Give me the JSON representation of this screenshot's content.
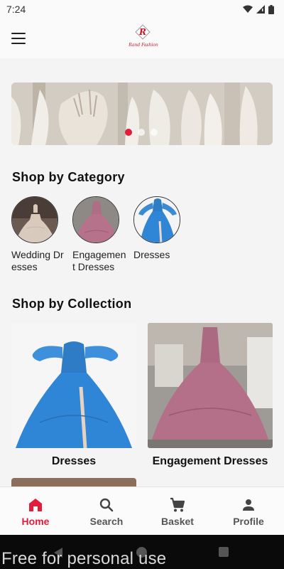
{
  "status_bar": {
    "time": "7:24"
  },
  "header": {
    "logo_text": "Rand Fashion",
    "logo_letter": "R"
  },
  "banner": {
    "slide_count": 3,
    "active_slide": 1
  },
  "category_section": {
    "title": "Shop by Category",
    "items": [
      {
        "label": "Wedding Dresses"
      },
      {
        "label": "Engagement Dresses"
      },
      {
        "label": "Dresses"
      }
    ]
  },
  "collection_section": {
    "title": "Shop by Collection",
    "items": [
      {
        "label": "Dresses"
      },
      {
        "label": "Engagement Dresses"
      }
    ]
  },
  "bottom_nav": {
    "items": [
      {
        "label": "Home",
        "icon": "home-icon",
        "active": true
      },
      {
        "label": "Search",
        "icon": "search-icon",
        "active": false
      },
      {
        "label": "Basket",
        "icon": "cart-icon",
        "active": false
      },
      {
        "label": "Profile",
        "icon": "person-icon",
        "active": false
      }
    ]
  },
  "watermark": "Free for personal use",
  "colors": {
    "accent": "#e11d3a",
    "nav_inactive": "#555555",
    "background": "#f4f4f4"
  }
}
